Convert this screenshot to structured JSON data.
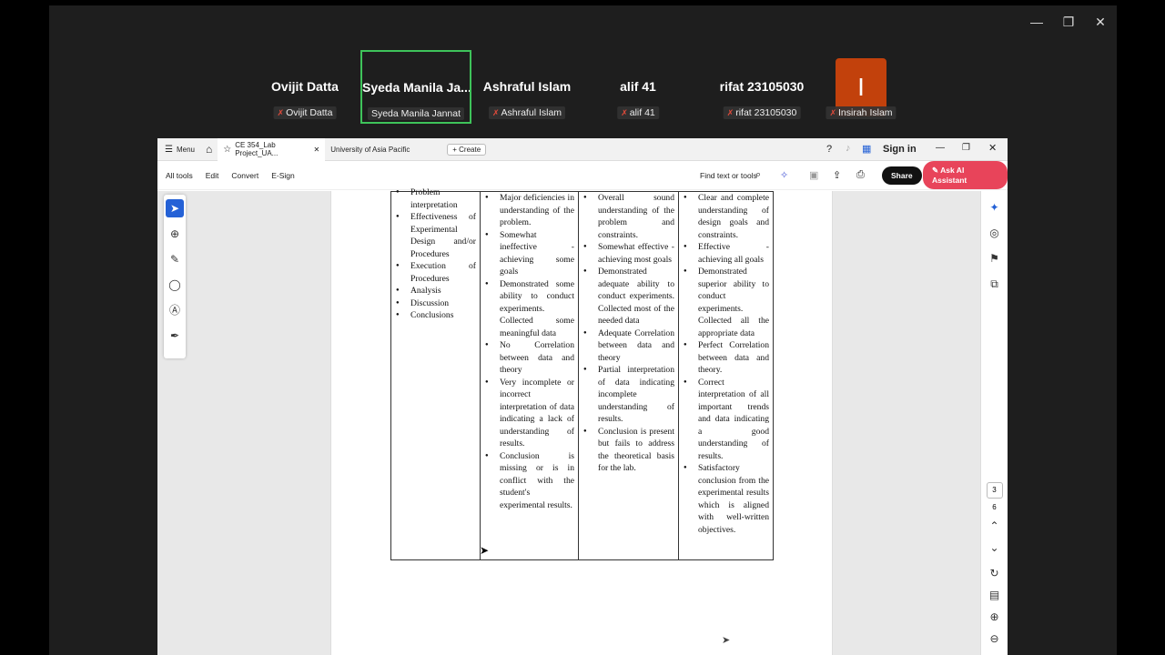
{
  "window": {
    "minimize_icon": "—",
    "restore_icon": "❐",
    "close_icon": "✕"
  },
  "participants": [
    {
      "name": "Ovijit Datta",
      "label": "Ovijit Datta",
      "muted": true
    },
    {
      "name": "Syeda  Manila  Ja...",
      "label": "Syeda Manila Jannat",
      "muted": false
    },
    {
      "name": "Ashraful Islam",
      "label": "Ashraful Islam",
      "muted": true
    },
    {
      "name": "alif 41",
      "label": "alif 41",
      "muted": true
    },
    {
      "name": "rifat 23105030",
      "label": "rifat 23105030",
      "muted": true
    },
    {
      "name": "",
      "label": "Insirah Islam",
      "muted": true,
      "avatar": "I"
    }
  ],
  "acrobat": {
    "menu": "Menu",
    "tabs": {
      "active": "CE 354_Lab Project_UA...",
      "other": "University of Asia Pacific",
      "create": "Create"
    },
    "signin": "Sign in",
    "toolbar": {
      "all_tools": "All tools",
      "edit": "Edit",
      "convert": "Convert",
      "esign": "E-Sign",
      "find": "Find text or tools",
      "share": "Share",
      "ai": "Ask AI Assistant"
    },
    "page": {
      "current": "3",
      "total": "6"
    }
  },
  "rubric": {
    "criteria": [
      "Problem interpretation",
      "Effectiveness of Experimental Design and/or Procedures",
      "Execution of Procedures",
      "Analysis",
      "Discussion",
      "Conclusions"
    ],
    "col1": [
      "Major deficiencies in understanding of the problem.",
      "Somewhat ineffective - achieving some goals",
      "Demonstrated some ability to conduct experiments. Collected some meaningful data",
      "No Correlation between data and theory",
      "Very incomplete or incorrect interpretation of data indicating a lack of understanding of results.",
      "Conclusion is missing or is in conflict with the student's experimental results."
    ],
    "col2": [
      "Overall sound understanding of the problem and constraints.",
      "Somewhat effective - achieving most goals",
      "Demonstrated adequate ability to conduct experiments. Collected most of the needed data",
      "Adequate Correlation between data and theory",
      "Partial interpretation of data indicating incomplete understanding of results.",
      "Conclusion is present but fails to address the theoretical basis for the lab."
    ],
    "col3": [
      "Clear and complete understanding of design goals and constraints.",
      "Effective - achieving all goals",
      "Demonstrated superior ability to conduct experiments. Collected all the appropriate data",
      "Perfect Correlation between data and theory.",
      "Correct interpretation of all important trends and data indicating a good understanding of results.",
      "Satisfactory conclusion from the experimental results which is aligned with well-written objectives."
    ]
  }
}
